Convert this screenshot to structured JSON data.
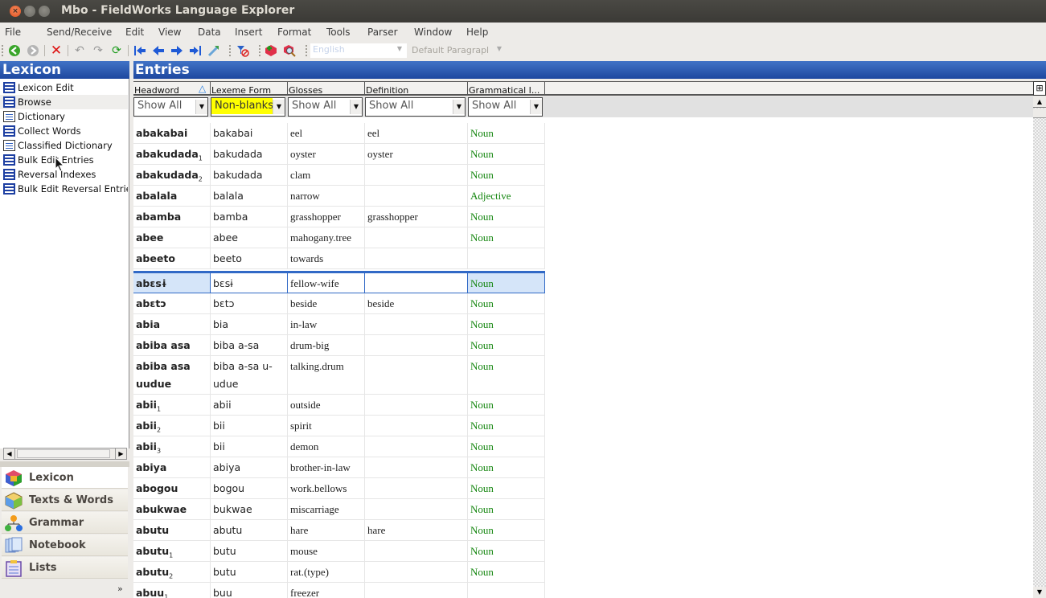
{
  "window": {
    "title": "Mbo - FieldWorks Language Explorer",
    "close": "×"
  },
  "menu": [
    "File",
    "Send/Receive",
    "Edit",
    "View",
    "Data",
    "Insert",
    "Format",
    "Tools",
    "Parser",
    "Window",
    "Help"
  ],
  "toolbar": {
    "writing_system": "English",
    "style": "Default Paragrapl",
    "icons": [
      "back-icon",
      "forward-icon",
      "delete-icon",
      "undo-icon",
      "redo-icon",
      "refresh-icon",
      "first-record-icon",
      "previous-record-icon",
      "next-record-icon",
      "last-record-icon",
      "link-icon",
      "clear-filter-icon",
      "insert-entry-icon",
      "find-entry-icon"
    ]
  },
  "left_pane": {
    "title": "Lexicon",
    "tools": [
      {
        "label": "Lexicon Edit",
        "icon": "grid"
      },
      {
        "label": "Browse",
        "icon": "list",
        "selected": true
      },
      {
        "label": "Dictionary",
        "icon": "doc"
      },
      {
        "label": "Collect Words",
        "icon": "list"
      },
      {
        "label": "Classified Dictionary",
        "icon": "doc"
      },
      {
        "label": "Bulk Edit Entries",
        "icon": "list"
      },
      {
        "label": "Reversal Indexes",
        "icon": "grid"
      },
      {
        "label": "Bulk Edit Reversal Entries",
        "icon": "list"
      }
    ],
    "areas": [
      {
        "label": "Lexicon",
        "active": true
      },
      {
        "label": "Texts & Words"
      },
      {
        "label": "Grammar"
      },
      {
        "label": "Notebook"
      },
      {
        "label": "Lists"
      }
    ],
    "more": "»"
  },
  "right_pane": {
    "title": "Entries",
    "columns": [
      "Headword",
      "Lexeme Form",
      "Glosses",
      "Definition",
      "Grammatical I..."
    ],
    "filters": [
      "Show All",
      "Non-blanks",
      "Show All",
      "Show All",
      "Show All"
    ],
    "rows": [
      {
        "hw": "abakabai",
        "sub": "",
        "lf": "bakabai",
        "gl": "eel",
        "df": "eel",
        "gi": "Noun"
      },
      {
        "hw": "abakudada",
        "sub": "1",
        "lf": "bakudada",
        "gl": "oyster",
        "df": "oyster",
        "gi": "Noun"
      },
      {
        "hw": "abakudada",
        "sub": "2",
        "lf": "bakudada",
        "gl": "clam",
        "df": "",
        "gi": "Noun"
      },
      {
        "hw": "abalala",
        "sub": "",
        "lf": "balala",
        "gl": "narrow",
        "df": "",
        "gi": "Adjective"
      },
      {
        "hw": "abamba",
        "sub": "",
        "lf": "bamba",
        "gl": "grasshopper",
        "df": "grasshopper",
        "gi": "Noun"
      },
      {
        "hw": "abee",
        "sub": "",
        "lf": "abee",
        "gl": "mahogany.tree",
        "df": "",
        "gi": "Noun"
      },
      {
        "hw": "abeeto",
        "sub": "",
        "lf": "beeto",
        "gl": "towards",
        "df": "",
        "gi": ""
      },
      {
        "hw": "abɛsɨ",
        "sub": "",
        "lf": "bɛsɨ",
        "gl": "fellow-wife",
        "df": "",
        "gi": "Noun",
        "selected": true
      },
      {
        "hw": "abɛtɔ",
        "sub": "",
        "lf": "bɛtɔ",
        "gl": "beside",
        "df": "beside",
        "gi": "Noun"
      },
      {
        "hw": "abia",
        "sub": "",
        "lf": "bia",
        "gl": "in-law",
        "df": "",
        "gi": "Noun"
      },
      {
        "hw": "abiba asa",
        "sub": "",
        "lf": "biba a-sa",
        "gl": "drum-big",
        "df": "",
        "gi": "Noun"
      },
      {
        "hw": "abiba asa uudue",
        "sub": "",
        "lf": "biba a-sa u-udue",
        "gl": "talking.drum",
        "df": "",
        "gi": "Noun",
        "tall": true
      },
      {
        "hw": "abii",
        "sub": "1",
        "lf": "abii",
        "gl": "outside",
        "df": "",
        "gi": "Noun"
      },
      {
        "hw": "abii",
        "sub": "2",
        "lf": "bii",
        "gl": "spirit",
        "df": "",
        "gi": "Noun"
      },
      {
        "hw": "abii",
        "sub": "3",
        "lf": "bii",
        "gl": "demon",
        "df": "",
        "gi": "Noun"
      },
      {
        "hw": "abiya",
        "sub": "",
        "lf": "abiya",
        "gl": "brother-in-law",
        "df": "",
        "gi": "Noun"
      },
      {
        "hw": "abogou",
        "sub": "",
        "lf": "bogou",
        "gl": "work.bellows",
        "df": "",
        "gi": "Noun"
      },
      {
        "hw": "abukwae",
        "sub": "",
        "lf": "bukwae",
        "gl": "miscarriage",
        "df": "",
        "gi": "Noun"
      },
      {
        "hw": "abutu",
        "sub": "",
        "lf": "abutu",
        "gl": "hare",
        "df": "hare",
        "gi": "Noun"
      },
      {
        "hw": "abutu",
        "sub": "1",
        "lf": "butu",
        "gl": "mouse",
        "df": "",
        "gi": "Noun"
      },
      {
        "hw": "abutu",
        "sub": "2",
        "lf": "butu",
        "gl": "rat.(type)",
        "df": "",
        "gi": "Noun"
      },
      {
        "hw": "abuu",
        "sub": "1",
        "lf": "buu",
        "gl": "freezer",
        "df": "",
        "gi": ""
      }
    ]
  }
}
